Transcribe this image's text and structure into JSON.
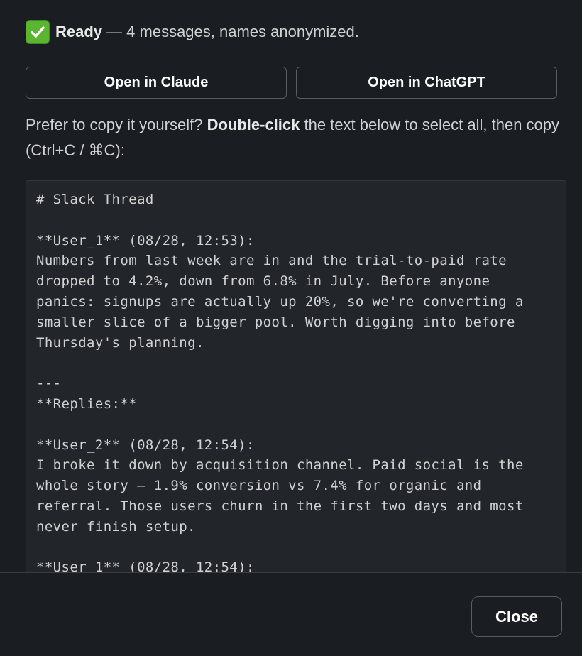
{
  "status": {
    "icon": "check-mark-icon",
    "icon_color": "#5cb531",
    "ready_label": "Ready",
    "detail": "— 4 messages, names anonymized."
  },
  "buttons": {
    "open_claude": "Open in Claude",
    "open_chatgpt": "Open in ChatGPT",
    "close": "Close"
  },
  "hint": {
    "prefix": "Prefer to copy it yourself? ",
    "bold": "Double-click",
    "suffix": " the text below to select all, then copy (Ctrl+C / ⌘C):"
  },
  "transcript": "# Slack Thread\n\n**User_1** (08/28, 12:53):\nNumbers from last week are in and the trial-to-paid rate dropped to 4.2%, down from 6.8% in July. Before anyone panics: signups are actually up 20%, so we're converting a smaller slice of a bigger pool. Worth digging into before Thursday's planning.\n\n---\n**Replies:**\n\n**User_2** (08/28, 12:54):\nI broke it down by acquisition channel. Paid social is the whole story — 1.9% conversion vs 7.4% for organic and referral. Those users churn in the first two days and most never finish setup.\n\n**User_1** (08/28, 12:54):"
}
